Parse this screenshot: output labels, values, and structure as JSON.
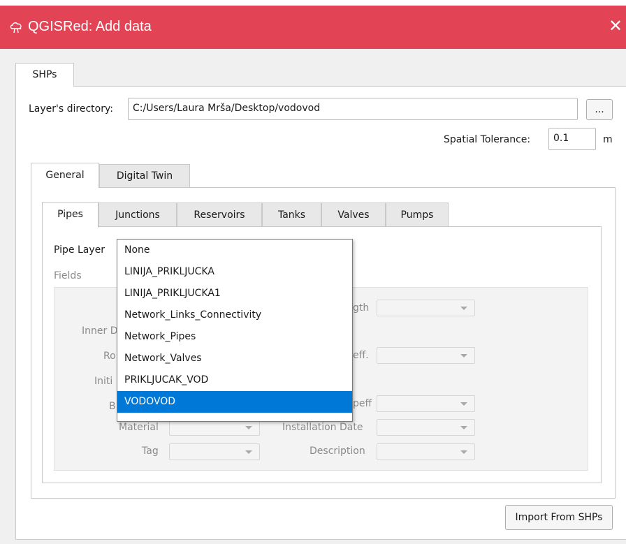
{
  "window": {
    "title": "QGISRed: Add data",
    "close_glyph": "✕",
    "accent": "#e24455",
    "app_icon": "qgisred-cloud-icon"
  },
  "outer_tabs": [
    {
      "label": "SHPs",
      "active": true
    }
  ],
  "layer_dir": {
    "label": "Layer's directory:",
    "value": "C:/Users/Laura Mrša/Desktop/vodovod",
    "browse_label": "..."
  },
  "tolerance": {
    "label": "Spatial Tolerance:",
    "value": "0.1",
    "unit": "m"
  },
  "group_tabs": [
    {
      "label": "General",
      "active": true
    },
    {
      "label": "Digital Twin",
      "active": false
    }
  ],
  "element_tabs": [
    {
      "label": "Pipes",
      "active": true
    },
    {
      "label": "Junctions",
      "active": false
    },
    {
      "label": "Reservoirs",
      "active": false
    },
    {
      "label": "Tanks",
      "active": false
    },
    {
      "label": "Valves",
      "active": false
    },
    {
      "label": "Pumps",
      "active": false
    }
  ],
  "pipe_layer": {
    "label": "Pipe Layer",
    "options": [
      "None",
      "LINIJA_PRIKLJUCKA",
      "LINIJA_PRIKLJUCKA1",
      "Network_Links_Connectivity",
      "Network_Pipes",
      "Network_Valves",
      "PRIKLJUCAK_VOD",
      "VODOVOD"
    ],
    "selected": "VODOVOD",
    "selection_color": "#0078d7"
  },
  "fields": {
    "label": "Fields",
    "left_labels": [
      "Inner D",
      "Ro",
      "Initi",
      "B",
      "Material",
      "Tag"
    ],
    "right_labels": [
      "gth",
      "eff.",
      "peff",
      "Installation Date",
      "Description"
    ]
  },
  "import_button": {
    "label": "Import From SHPs"
  }
}
